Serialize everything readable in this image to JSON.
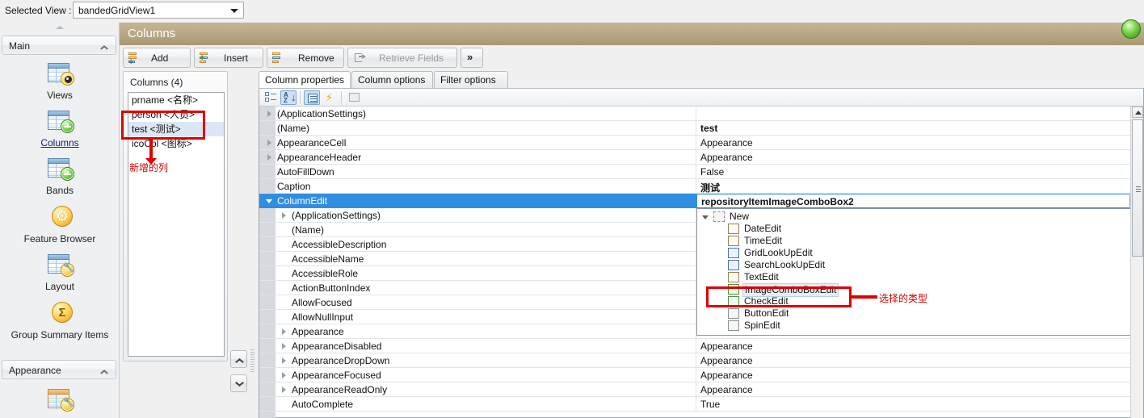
{
  "topbar": {
    "label": "Selected View :",
    "selected_view": "bandedGridView1"
  },
  "sidebar": {
    "group_main": "Main",
    "group_appearance": "Appearance",
    "items": [
      {
        "label": "Views",
        "icon": "grid-eye-icon"
      },
      {
        "label": "Columns",
        "icon": "grid-plus-icon"
      },
      {
        "label": "Bands",
        "icon": "grid-plus-icon"
      },
      {
        "label": "Feature Browser",
        "icon": "gear-icon"
      },
      {
        "label": "Layout",
        "icon": "grid-wrench-icon"
      },
      {
        "label": "Group Summary Items",
        "icon": "sigma-icon"
      }
    ],
    "appearance_item": {
      "label": "",
      "icon": "grid-wrench-orange-icon"
    }
  },
  "header": {
    "title": "Columns"
  },
  "toolbar": {
    "add": "Add",
    "insert": "Insert",
    "remove": "Remove",
    "retrieve_fields": "Retrieve Fields",
    "more": "»"
  },
  "columns_panel": {
    "caption": "Columns (4)",
    "items": [
      {
        "label": "prname <名称>",
        "selected": false
      },
      {
        "label": "person <人员>",
        "selected": false
      },
      {
        "label": "test <测试>",
        "selected": true
      },
      {
        "label": "icoCol <图标>",
        "selected": false
      }
    ]
  },
  "tabs": [
    {
      "label": "Column properties",
      "active": true
    },
    {
      "label": "Column options",
      "active": false
    },
    {
      "label": "Filter options",
      "active": false
    }
  ],
  "property_grid": {
    "toolbar_icons": [
      "categorized-icon",
      "alphabetical-sort-icon",
      "properties-icon",
      "events-icon",
      "property-pages-icon"
    ],
    "rows": [
      {
        "name": "(ApplicationSettings)",
        "value": "",
        "indent": 0,
        "expander": "collapsed",
        "bold": false
      },
      {
        "name": "(Name)",
        "value": "test",
        "indent": 0,
        "expander": "none",
        "bold": true
      },
      {
        "name": "AppearanceCell",
        "value": "Appearance",
        "indent": 0,
        "expander": "collapsed",
        "bold": false
      },
      {
        "name": "AppearanceHeader",
        "value": "Appearance",
        "indent": 0,
        "expander": "collapsed",
        "bold": false
      },
      {
        "name": "AutoFillDown",
        "value": "False",
        "indent": 0,
        "expander": "none",
        "bold": false
      },
      {
        "name": "Caption",
        "value": "测试",
        "indent": 0,
        "expander": "none",
        "bold": true
      },
      {
        "name": "ColumnEdit",
        "value": "repositoryItemImageComboBox2",
        "indent": 0,
        "expander": "expanded",
        "bold": true,
        "selected": true,
        "editing": true
      },
      {
        "name": "(ApplicationSettings)",
        "value": "",
        "indent": 1,
        "expander": "collapsed",
        "bold": false
      },
      {
        "name": "(Name)",
        "value": "",
        "indent": 1,
        "expander": "none",
        "bold": false
      },
      {
        "name": "AccessibleDescription",
        "value": "",
        "indent": 1,
        "expander": "none",
        "bold": false
      },
      {
        "name": "AccessibleName",
        "value": "",
        "indent": 1,
        "expander": "none",
        "bold": false
      },
      {
        "name": "AccessibleRole",
        "value": "",
        "indent": 1,
        "expander": "none",
        "bold": false
      },
      {
        "name": "ActionButtonIndex",
        "value": "",
        "indent": 1,
        "expander": "none",
        "bold": false
      },
      {
        "name": "AllowFocused",
        "value": "",
        "indent": 1,
        "expander": "none",
        "bold": false
      },
      {
        "name": "AllowNullInput",
        "value": "",
        "indent": 1,
        "expander": "none",
        "bold": false
      },
      {
        "name": "Appearance",
        "value": "",
        "indent": 0,
        "expander": "collapsed",
        "bold": false
      },
      {
        "name": "AppearanceDisabled",
        "value": "Appearance",
        "indent": 0,
        "expander": "collapsed",
        "bold": false
      },
      {
        "name": "AppearanceDropDown",
        "value": "Appearance",
        "indent": 0,
        "expander": "collapsed",
        "bold": false
      },
      {
        "name": "AppearanceFocused",
        "value": "Appearance",
        "indent": 0,
        "expander": "collapsed",
        "bold": false
      },
      {
        "name": "AppearanceReadOnly",
        "value": "Appearance",
        "indent": 0,
        "expander": "collapsed",
        "bold": false
      },
      {
        "name": "AutoComplete",
        "value": "True",
        "indent": 0,
        "expander": "none",
        "bold": false
      }
    ]
  },
  "editor_dropdown": {
    "items": [
      {
        "label": "New",
        "indent": 0,
        "icon": "new-icon",
        "selected": false
      },
      {
        "label": "DateEdit",
        "indent": 1,
        "icon": "date-edit-icon",
        "selected": false
      },
      {
        "label": "TimeEdit",
        "indent": 1,
        "icon": "time-edit-icon",
        "selected": false
      },
      {
        "label": "GridLookUpEdit",
        "indent": 1,
        "icon": "grid-lookup-edit-icon",
        "selected": false
      },
      {
        "label": "SearchLookUpEdit",
        "indent": 1,
        "icon": "search-lookup-edit-icon",
        "selected": false
      },
      {
        "label": "TextEdit",
        "indent": 1,
        "icon": "text-edit-icon",
        "selected": false
      },
      {
        "label": "ImageComboBoxEdit",
        "indent": 1,
        "icon": "image-combobox-edit-icon",
        "selected": true
      },
      {
        "label": "CheckEdit",
        "indent": 1,
        "icon": "check-edit-icon",
        "selected": false
      },
      {
        "label": "ButtonEdit",
        "indent": 1,
        "icon": "button-edit-icon",
        "selected": false
      },
      {
        "label": "SpinEdit",
        "indent": 1,
        "icon": "spin-edit-icon",
        "selected": false
      }
    ]
  },
  "annotations": {
    "new_column": "新增的列",
    "selected_type": "选择的类型",
    "color": "#d00000"
  }
}
